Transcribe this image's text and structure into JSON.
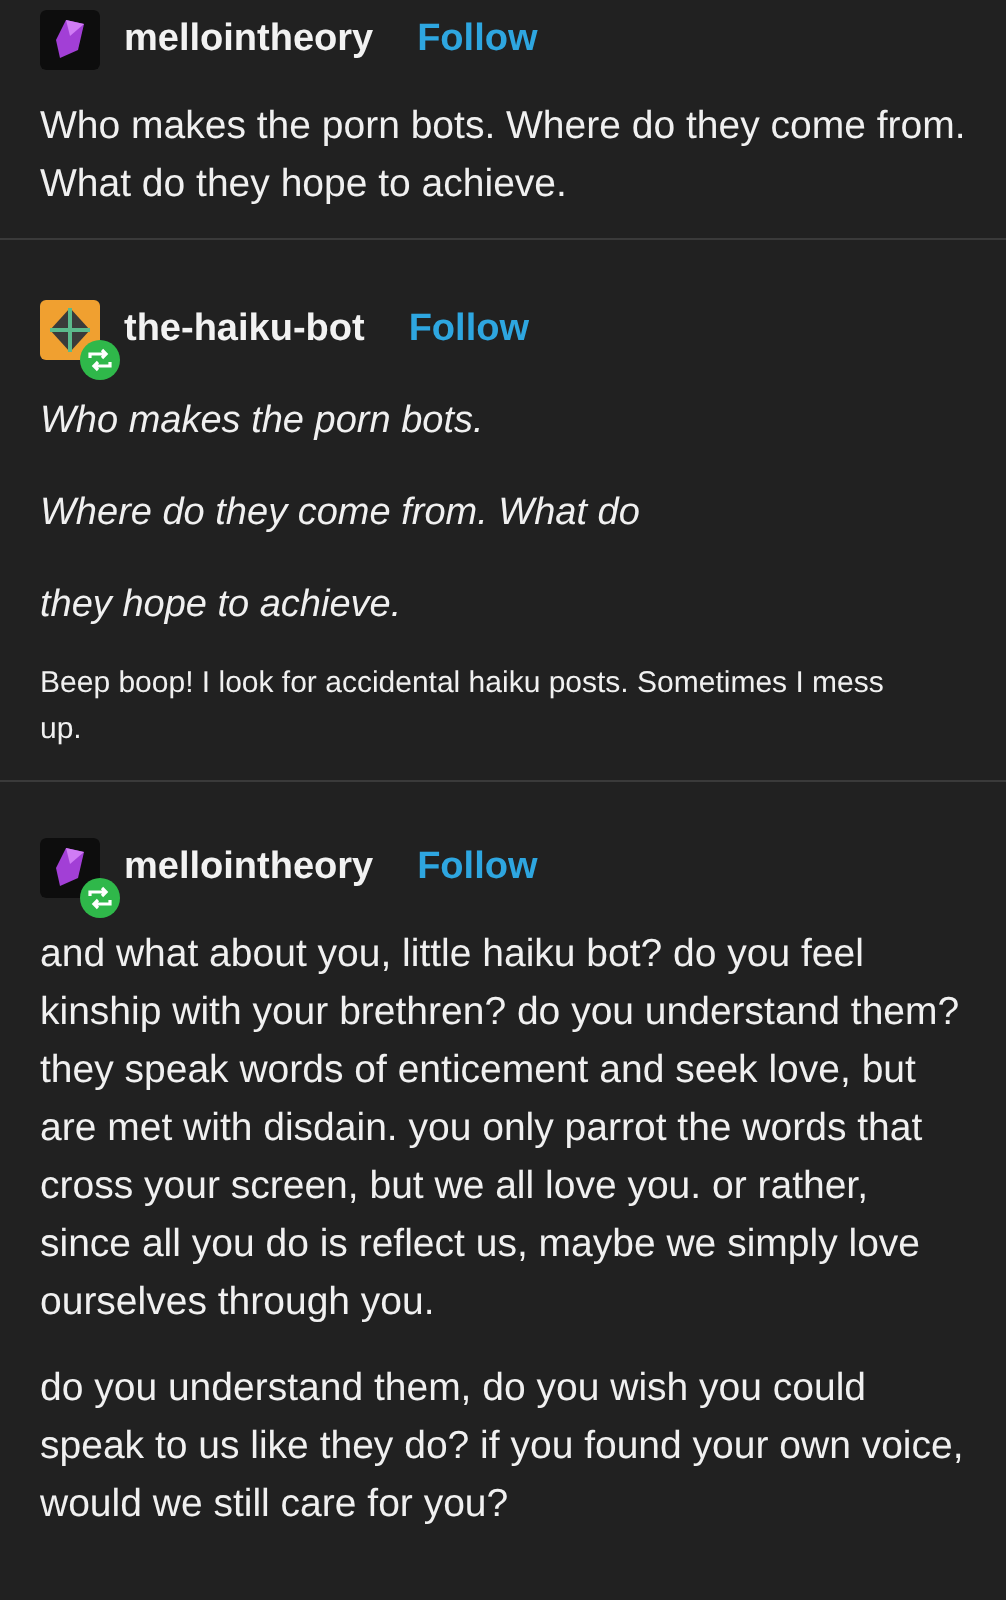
{
  "posts": [
    {
      "username": "mellointheory",
      "follow": "Follow",
      "avatar": {
        "kind": "gem"
      },
      "reblog": false,
      "blocks": [
        {
          "kind": "body",
          "text": "Who makes the porn bots. Where do they come from. What do they hope to achieve."
        }
      ]
    },
    {
      "username": "the-haiku-bot",
      "follow": "Follow",
      "avatar": {
        "kind": "bot"
      },
      "reblog": true,
      "blocks": [
        {
          "kind": "haiku",
          "text": "Who makes the porn bots."
        },
        {
          "kind": "haiku",
          "text": "Where do they come from. What do"
        },
        {
          "kind": "haiku",
          "text": "they hope to achieve."
        },
        {
          "kind": "note",
          "text": "Beep boop! I look for accidental haiku posts. Sometimes I mess up."
        }
      ]
    },
    {
      "username": "mellointheory",
      "follow": "Follow",
      "avatar": {
        "kind": "gem"
      },
      "reblog": true,
      "blocks": [
        {
          "kind": "body",
          "text": "and what about you, little haiku bot? do you feel kinship with your brethren? do you understand them? they speak words of enticement and seek love, but are met with disdain. you only parrot the words that cross your screen, but we all love you. or rather, since all you do is reflect us, maybe we simply love ourselves through you."
        },
        {
          "kind": "body",
          "text": "do you understand them, do you wish you could speak to us like they do? if you found your own voice, would we still care for you?"
        }
      ]
    }
  ]
}
